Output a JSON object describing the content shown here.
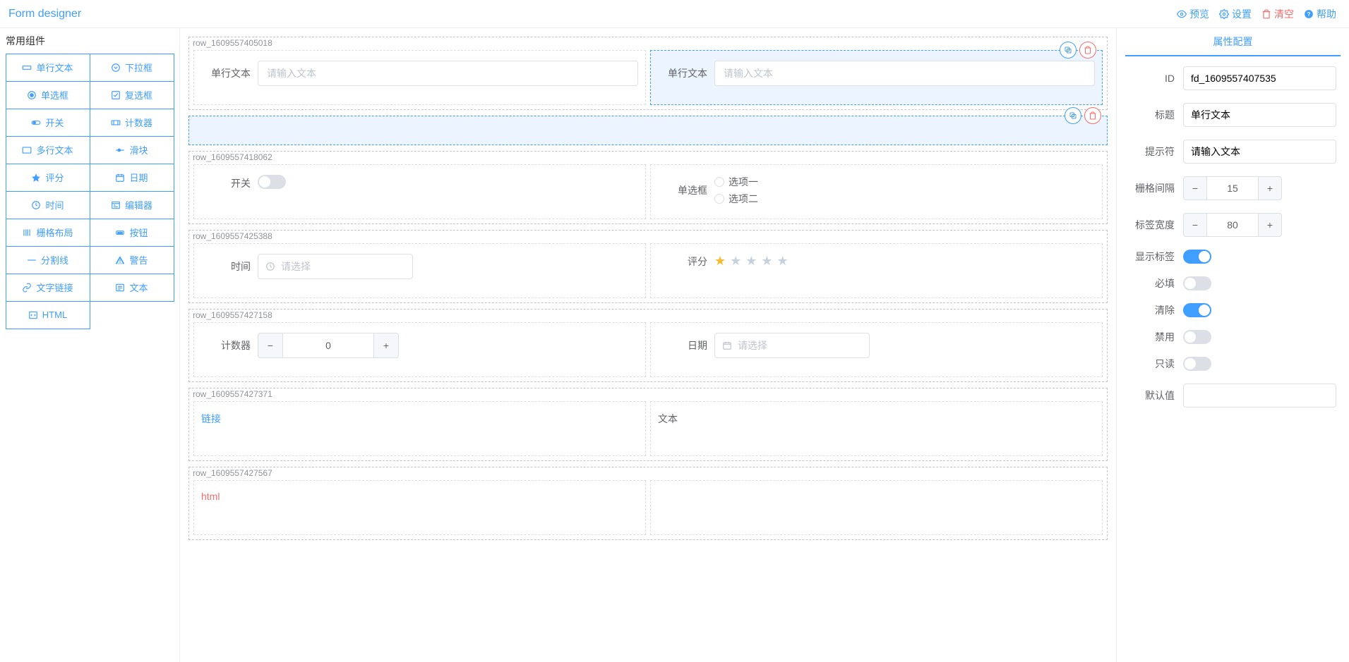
{
  "header": {
    "title": "Form designer",
    "actions": {
      "preview": "预览",
      "settings": "设置",
      "clear": "清空",
      "help": "帮助"
    }
  },
  "left": {
    "groupTitle": "常用组件",
    "items": [
      {
        "label": "单行文本",
        "icon": "input"
      },
      {
        "label": "下拉框",
        "icon": "select"
      },
      {
        "label": "单选框",
        "icon": "radio"
      },
      {
        "label": "复选框",
        "icon": "checkbox"
      },
      {
        "label": "开关",
        "icon": "switch"
      },
      {
        "label": "计数器",
        "icon": "counter"
      },
      {
        "label": "多行文本",
        "icon": "textarea"
      },
      {
        "label": "滑块",
        "icon": "slider"
      },
      {
        "label": "评分",
        "icon": "star"
      },
      {
        "label": "日期",
        "icon": "date"
      },
      {
        "label": "时间",
        "icon": "time"
      },
      {
        "label": "编辑器",
        "icon": "editor"
      },
      {
        "label": "栅格布局",
        "icon": "grid"
      },
      {
        "label": "按钮",
        "icon": "button"
      },
      {
        "label": "分割线",
        "icon": "divider"
      },
      {
        "label": "警告",
        "icon": "alert"
      },
      {
        "label": "文字链接",
        "icon": "link"
      },
      {
        "label": "文本",
        "icon": "text"
      },
      {
        "label": "HTML",
        "icon": "html"
      }
    ]
  },
  "canvas": {
    "rows": [
      {
        "id": "row_1609557405018",
        "cells": [
          {
            "type": "input",
            "label": "单行文本",
            "placeholder": "请输入文本"
          },
          {
            "type": "input",
            "label": "单行文本",
            "placeholder": "请输入文本",
            "selected": true
          }
        ]
      },
      {
        "id": "",
        "selectedRow": true,
        "cells": []
      },
      {
        "id": "row_1609557418062",
        "cells": [
          {
            "type": "switch",
            "label": "开关"
          },
          {
            "type": "radio",
            "label": "单选框",
            "options": [
              "选项一",
              "选项二"
            ]
          }
        ]
      },
      {
        "id": "row_1609557425388",
        "cells": [
          {
            "type": "time",
            "label": "时间",
            "placeholder": "请选择"
          },
          {
            "type": "rate",
            "label": "评分",
            "value": 1
          }
        ]
      },
      {
        "id": "row_1609557427158",
        "cells": [
          {
            "type": "counter",
            "label": "计数器",
            "value": "0"
          },
          {
            "type": "date",
            "label": "日期",
            "placeholder": "请选择"
          }
        ]
      },
      {
        "id": "row_1609557427371",
        "cells": [
          {
            "type": "link",
            "text": "链接"
          },
          {
            "type": "textlabel",
            "text": "文本"
          }
        ]
      },
      {
        "id": "row_1609557427567",
        "cells": [
          {
            "type": "html",
            "text": "html"
          },
          {
            "type": "empty"
          }
        ]
      }
    ]
  },
  "right": {
    "tab": "属性配置",
    "props": {
      "id_label": "ID",
      "id_value": "fd_1609557407535",
      "title_label": "标题",
      "title_value": "单行文本",
      "placeholder_label": "提示符",
      "placeholder_value": "请输入文本",
      "gutter_label": "栅格间隔",
      "gutter_value": "15",
      "labelwidth_label": "标签宽度",
      "labelwidth_value": "80",
      "showlabel_label": "显示标签",
      "showlabel_on": true,
      "required_label": "必填",
      "required_on": false,
      "clearable_label": "清除",
      "clearable_on": true,
      "disabled_label": "禁用",
      "disabled_on": false,
      "readonly_label": "只读",
      "readonly_on": false,
      "default_label": "默认值",
      "default_value": ""
    }
  }
}
